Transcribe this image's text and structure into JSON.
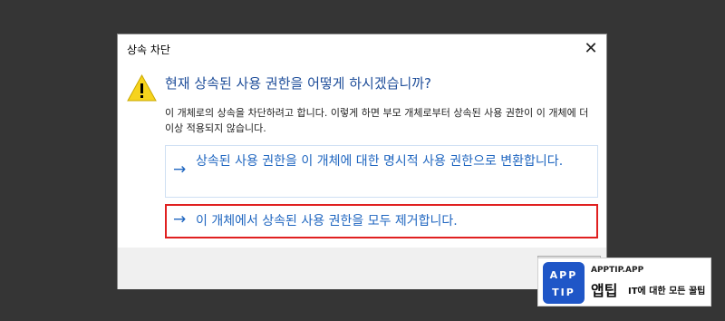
{
  "dialog": {
    "title": "상속 차단",
    "close_symbol": "✕",
    "question": "현재 상속된 사용 권한을 어떻게 하시겠습니까?",
    "description": "이 개체로의 상속을 차단하려고 합니다. 이렇게 하면 부모 개체로부터 상속된 사용 권한이 이 개체에 더 이상 적용되지 않습니다.",
    "options": [
      {
        "arrow": "→",
        "label": "상속된 사용 권한을 이 개체에 대한 명시적 사용 권한으로 변환합니다."
      },
      {
        "arrow": "→",
        "label": "이 개체에서 상속된 사용 권한을 모두 제거합니다."
      }
    ]
  },
  "watermark": {
    "logo_line1": "APP",
    "logo_line2": "TIP",
    "url": "APPTIP.APP",
    "name": "앱팁",
    "tagline": "IT에 대한 모든 꿀팁"
  },
  "colors": {
    "accent": "#1f66c0",
    "highlight_border": "#e02020",
    "logo_bg": "#1f56c7"
  }
}
